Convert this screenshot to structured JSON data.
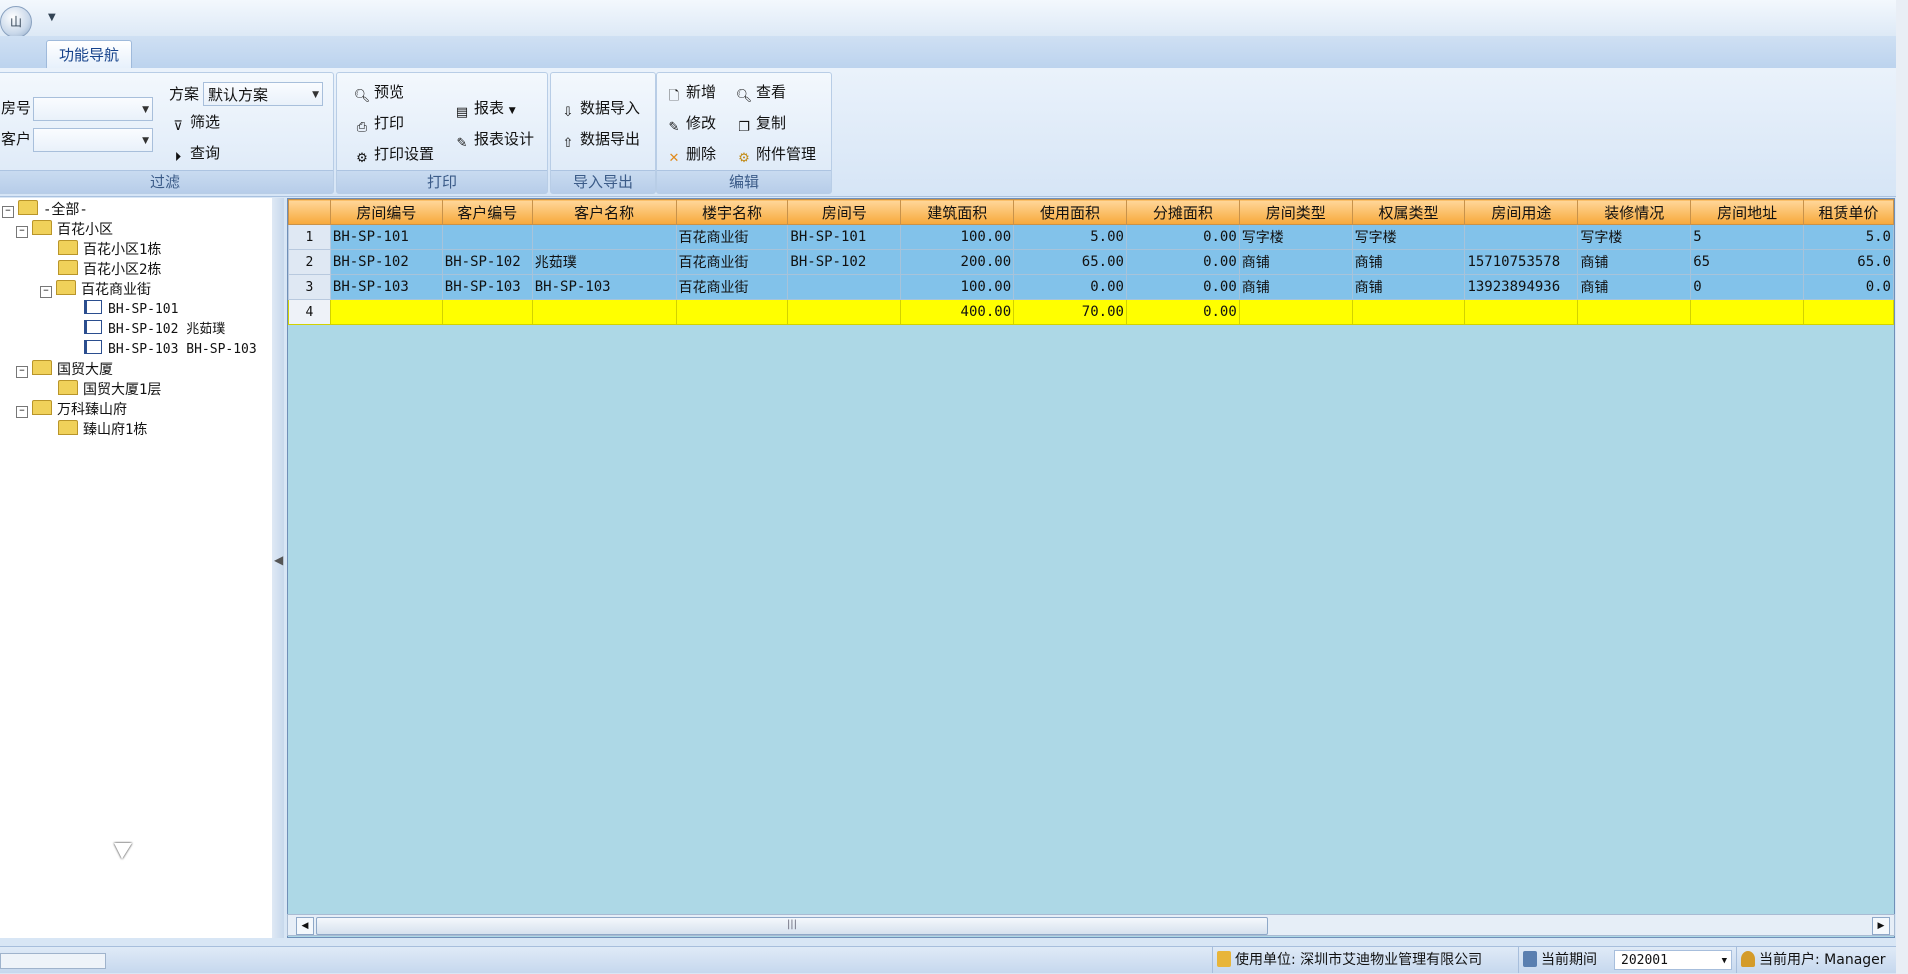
{
  "titlebar": {
    "orb_label": "山"
  },
  "ribbon": {
    "active_tab": "功能导航",
    "filter": {
      "caption": "过滤",
      "room_label": "房号",
      "customer_label": "客户",
      "room_value": "",
      "customer_value": "",
      "scheme_label": "方案",
      "scheme_value": "默认方案",
      "filter_btn": "筛选",
      "query_btn": "查询"
    },
    "print": {
      "caption": "打印",
      "preview": "预览",
      "print": "打印",
      "print_settings": "打印设置",
      "report": "报表",
      "report_design": "报表设计"
    },
    "io": {
      "caption": "导入导出",
      "import": "数据导入",
      "export": "数据导出"
    },
    "edit": {
      "caption": "编辑",
      "add": "新增",
      "modify": "修改",
      "delete": "删除",
      "view": "查看",
      "copy": "复制",
      "attachments": "附件管理"
    }
  },
  "tree": {
    "nodes": [
      {
        "label": "-全部-"
      },
      {
        "label": "百花小区"
      },
      {
        "label": "百花小区1栋"
      },
      {
        "label": "百花小区2栋"
      },
      {
        "label": "百花商业街"
      },
      {
        "label": "BH-SP-101"
      },
      {
        "label": "BH-SP-102 兆茹璞"
      },
      {
        "label": "BH-SP-103 BH-SP-103"
      },
      {
        "label": "国贸大厦"
      },
      {
        "label": "国贸大厦1层"
      },
      {
        "label": "万科臻山府"
      },
      {
        "label": "臻山府1栋"
      }
    ]
  },
  "grid": {
    "columns": [
      "房间编号",
      "客户编号",
      "客户名称",
      "楼宇名称",
      "房间号",
      "建筑面积",
      "使用面积",
      "分摊面积",
      "房间类型",
      "权属类型",
      "房间用途",
      "装修情况",
      "房间地址",
      "租赁单价"
    ],
    "rows": [
      {
        "n": "1",
        "cells": [
          "BH-SP-101",
          "",
          "",
          "百花商业街",
          "BH-SP-101",
          "100.00",
          "5.00",
          "0.00",
          "写字楼",
          "写字楼",
          "",
          "写字楼",
          "5",
          "5.0"
        ]
      },
      {
        "n": "2",
        "cells": [
          "BH-SP-102",
          "BH-SP-102",
          "兆茹璞",
          "百花商业街",
          "BH-SP-102",
          "200.00",
          "65.00",
          "0.00",
          "商铺",
          "商铺",
          "15710753578",
          "商铺",
          "65",
          "65.0"
        ]
      },
      {
        "n": "3",
        "cells": [
          "BH-SP-103",
          "BH-SP-103",
          "BH-SP-103",
          "百花商业街",
          "",
          "100.00",
          "0.00",
          "0.00",
          "商铺",
          "商铺",
          "13923894936",
          "商铺",
          "0",
          "0.0"
        ]
      }
    ],
    "total": {
      "n": "4",
      "cells": [
        "",
        "",
        "",
        "",
        "",
        "400.00",
        "70.00",
        "0.00",
        "",
        "",
        "",
        "",
        "",
        ""
      ]
    }
  },
  "statusbar": {
    "org_label": "使用单位: 深圳市艾迪物业管理有限公司",
    "period_label": "当前期间",
    "period_value": "202001",
    "user_label": "当前用户: Manager"
  }
}
